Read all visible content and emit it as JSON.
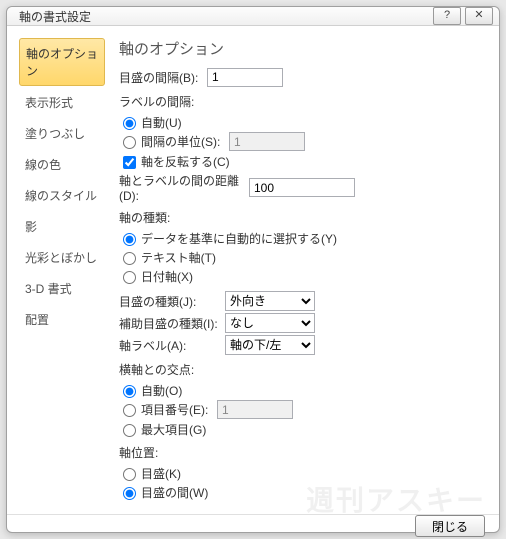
{
  "title": "軸の書式設定",
  "titlebar": {
    "help": "?",
    "close": "✕"
  },
  "tabs": [
    "軸のオプション",
    "表示形式",
    "塗りつぶし",
    "線の色",
    "線のスタイル",
    "影",
    "光彩とぼかし",
    "3-D 書式",
    "配置"
  ],
  "panel": {
    "heading": "軸のオプション",
    "major_interval_label": "目盛の間隔(B):",
    "major_interval_value": "1",
    "label_interval_label": "ラベルの間隔:",
    "label_interval_auto": "自動(U)",
    "label_interval_unit": "間隔の単位(S):",
    "label_interval_unit_value": "1",
    "reverse_axis": "軸を反転する(C)",
    "axis_label_distance_label": "軸とラベルの間の距離(D):",
    "axis_label_distance_value": "100",
    "axis_type_label": "軸の種類:",
    "axis_type_auto": "データを基準に自動的に選択する(Y)",
    "axis_type_text": "テキスト軸(T)",
    "axis_type_date": "日付軸(X)",
    "tick_type_label": "目盛の種類(J):",
    "tick_type_value": "外向き",
    "minor_tick_type_label": "補助目盛の種類(I):",
    "minor_tick_type_value": "なし",
    "axis_label_pos_label": "軸ラベル(A):",
    "axis_label_pos_value": "軸の下/左",
    "cross_label": "横軸との交点:",
    "cross_auto": "自動(O)",
    "cross_item": "項目番号(E):",
    "cross_item_value": "1",
    "cross_max": "最大項目(G)",
    "axis_pos_label": "軸位置:",
    "axis_pos_tick": "目盛(K)",
    "axis_pos_between": "目盛の間(W)"
  },
  "footer": {
    "close": "閉じる"
  },
  "watermark": "週刊アスキー"
}
